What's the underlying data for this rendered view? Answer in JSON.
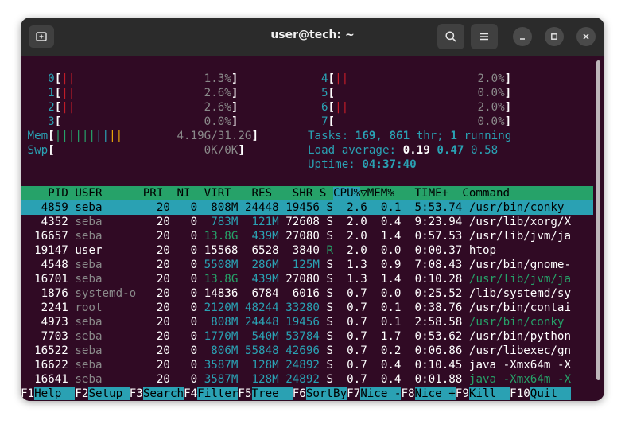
{
  "window": {
    "title": "user@tech: ~"
  },
  "cpu": [
    {
      "id": "0",
      "bars": "||",
      "pct": "1.3%"
    },
    {
      "id": "1",
      "bars": "||",
      "pct": "2.6%"
    },
    {
      "id": "2",
      "bars": "||",
      "pct": "2.6%"
    },
    {
      "id": "3",
      "bars": "",
      "pct": "0.0%"
    },
    {
      "id": "4",
      "bars": "||",
      "pct": "2.0%"
    },
    {
      "id": "5",
      "bars": "",
      "pct": "0.0%"
    },
    {
      "id": "6",
      "bars": "||",
      "pct": "2.0%"
    },
    {
      "id": "7",
      "bars": "",
      "pct": "0.0%"
    }
  ],
  "mem": {
    "label": "Mem",
    "bars": "||||||||||",
    "value": "4.19G/31.2G"
  },
  "swp": {
    "label": "Swp",
    "value": "0K/0K"
  },
  "tasks": {
    "label": "Tasks:",
    "count": "169",
    "threads": "861",
    "thr_label": "thr;",
    "running": "1",
    "running_label": "running"
  },
  "load": {
    "label": "Load average:",
    "l1": "0.19",
    "l5": "0.47",
    "l15": "0.58"
  },
  "uptime": {
    "label": "Uptime:",
    "value": "04:37:40"
  },
  "columns": [
    "PID",
    "USER",
    "PRI",
    "NI",
    "VIRT",
    "RES",
    "SHR",
    "S",
    "CPU%",
    "MEM%",
    "TIME+",
    "Command"
  ],
  "processes": [
    {
      "pid": "4859",
      "user": "seba",
      "pri": "20",
      "ni": "0",
      "virt": "808M",
      "res": "24448",
      "shr": "19456",
      "s": "S",
      "cpu": "2.6",
      "mem": "0.1",
      "time": "5:53.74",
      "cmd": "/usr/bin/conky"
    },
    {
      "pid": "4352",
      "user": "seba",
      "pri": "20",
      "ni": "0",
      "virt": "783M",
      "res": "121M",
      "shr": "72608",
      "s": "S",
      "cpu": "2.0",
      "mem": "0.4",
      "time": "9:23.94",
      "cmd": "/usr/lib/xorg/X"
    },
    {
      "pid": "16657",
      "user": "seba",
      "pri": "20",
      "ni": "0",
      "virt": "13.8G",
      "res": "439M",
      "shr": "27080",
      "s": "S",
      "cpu": "2.0",
      "mem": "1.4",
      "time": "0:57.53",
      "cmd": "/usr/lib/jvm/ja"
    },
    {
      "pid": "19147",
      "user": "user",
      "pri": "20",
      "ni": "0",
      "virt": "15568",
      "res": "6528",
      "shr": "3840",
      "s": "R",
      "cpu": "2.0",
      "mem": "0.0",
      "time": "0:00.37",
      "cmd": "htop"
    },
    {
      "pid": "4548",
      "user": "seba",
      "pri": "20",
      "ni": "0",
      "virt": "5508M",
      "res": "286M",
      "shr": "125M",
      "s": "S",
      "cpu": "1.3",
      "mem": "0.9",
      "time": "7:08.43",
      "cmd": "/usr/bin/gnome-"
    },
    {
      "pid": "16701",
      "user": "seba",
      "pri": "20",
      "ni": "0",
      "virt": "13.8G",
      "res": "439M",
      "shr": "27080",
      "s": "S",
      "cpu": "1.3",
      "mem": "1.4",
      "time": "0:10.28",
      "cmd": "/usr/lib/jvm/ja"
    },
    {
      "pid": "1876",
      "user": "systemd-o",
      "pri": "20",
      "ni": "0",
      "virt": "14836",
      "res": "6784",
      "shr": "6016",
      "s": "S",
      "cpu": "0.7",
      "mem": "0.0",
      "time": "0:25.52",
      "cmd": "/lib/systemd/sy"
    },
    {
      "pid": "2241",
      "user": "root",
      "pri": "20",
      "ni": "0",
      "virt": "2120M",
      "res": "48244",
      "shr": "33280",
      "s": "S",
      "cpu": "0.7",
      "mem": "0.1",
      "time": "0:38.76",
      "cmd": "/usr/bin/contai"
    },
    {
      "pid": "4973",
      "user": "seba",
      "pri": "20",
      "ni": "0",
      "virt": "808M",
      "res": "24448",
      "shr": "19456",
      "s": "S",
      "cpu": "0.7",
      "mem": "0.1",
      "time": "2:58.58",
      "cmd": "/usr/bin/conky"
    },
    {
      "pid": "7703",
      "user": "seba",
      "pri": "20",
      "ni": "0",
      "virt": "1770M",
      "res": "540M",
      "shr": "53784",
      "s": "S",
      "cpu": "0.7",
      "mem": "1.7",
      "time": "0:53.62",
      "cmd": "/usr/bin/python"
    },
    {
      "pid": "16522",
      "user": "seba",
      "pri": "20",
      "ni": "0",
      "virt": "806M",
      "res": "55848",
      "shr": "42696",
      "s": "S",
      "cpu": "0.7",
      "mem": "0.2",
      "time": "0:06.86",
      "cmd": "/usr/libexec/gn"
    },
    {
      "pid": "16622",
      "user": "seba",
      "pri": "20",
      "ni": "0",
      "virt": "3587M",
      "res": "128M",
      "shr": "24892",
      "s": "S",
      "cpu": "0.7",
      "mem": "0.4",
      "time": "0:10.45",
      "cmd": "java -Xmx64m -X"
    },
    {
      "pid": "16641",
      "user": "seba",
      "pri": "20",
      "ni": "0",
      "virt": "3587M",
      "res": "128M",
      "shr": "24892",
      "s": "S",
      "cpu": "0.7",
      "mem": "0.4",
      "time": "0:01.88",
      "cmd": "java -Xmx64m -X"
    }
  ],
  "fkeys": [
    {
      "key": "F1",
      "label": "Help"
    },
    {
      "key": "F2",
      "label": "Setup"
    },
    {
      "key": "F3",
      "label": "Search"
    },
    {
      "key": "F4",
      "label": "Filter"
    },
    {
      "key": "F5",
      "label": "Tree"
    },
    {
      "key": "F6",
      "label": "SortBy"
    },
    {
      "key": "F7",
      "label": "Nice -"
    },
    {
      "key": "F8",
      "label": "Nice +"
    },
    {
      "key": "F9",
      "label": "Kill"
    },
    {
      "key": "F10",
      "label": "Quit"
    }
  ],
  "colors": {
    "terminal_bg": "#300a24",
    "header_green": "#26a269",
    "selection_cyan": "#2aa1b3",
    "bar_red": "#c01c28"
  },
  "icons": {
    "new_tab": "new-tab-icon",
    "search": "search-icon",
    "menu": "hamburger-menu-icon",
    "minimize": "minimize-icon",
    "maximize": "maximize-icon",
    "close": "close-icon"
  }
}
